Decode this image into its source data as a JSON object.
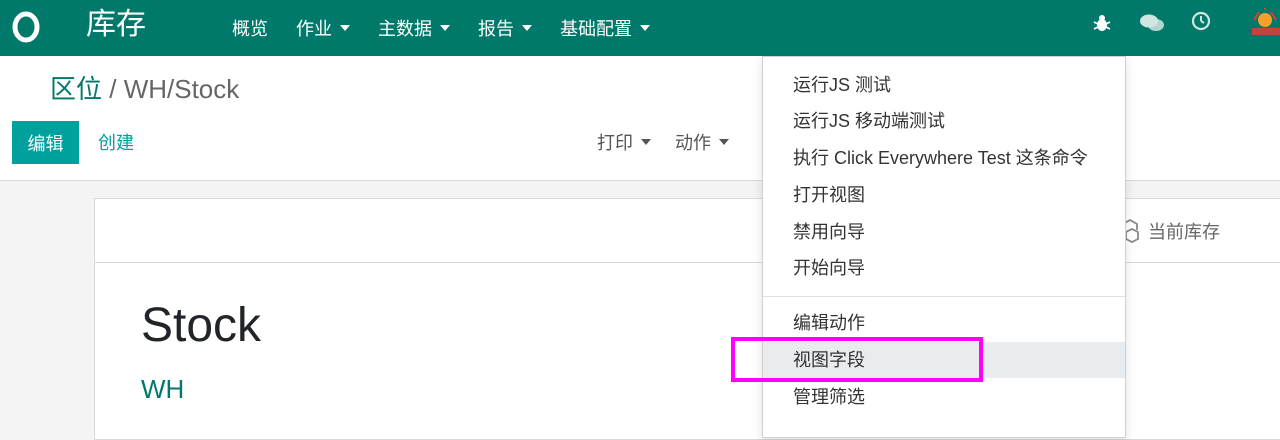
{
  "navbar": {
    "app_name": "库存",
    "menu": [
      {
        "label": "概览"
      },
      {
        "label": "作业"
      },
      {
        "label": "主数据"
      },
      {
        "label": "报告"
      },
      {
        "label": "基础配置"
      }
    ],
    "brand_color": "#00796b"
  },
  "breadcrumb": {
    "parent": "区位",
    "separator": " / ",
    "current": "WH/Stock"
  },
  "actions": {
    "edit_label": "编辑",
    "create_label": "创建",
    "print_label": "打印",
    "action_label": "动作"
  },
  "smart_button": {
    "label": "当前库存"
  },
  "record": {
    "name": "Stock",
    "warehouse": "WH"
  },
  "debug_menu": {
    "items": [
      "运行JS 测试",
      "运行JS 移动端测试",
      "执行 Click Everywhere Test 这条命令",
      "打开视图",
      "禁用向导",
      "开始向导",
      "编辑动作",
      "视图字段",
      "管理筛选"
    ],
    "highlighted": "视图字段"
  }
}
